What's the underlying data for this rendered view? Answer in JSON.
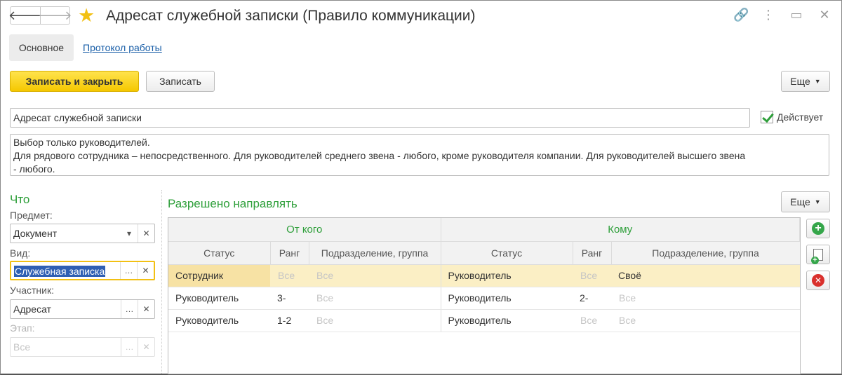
{
  "window": {
    "title": "Адресат служебной записки (Правило коммуникации)",
    "back_icon": "arrow-left-icon",
    "forward_icon": "arrow-right-icon",
    "favorite_icon": "star-icon",
    "icons": [
      "link-icon",
      "more-vertical-icon",
      "expand-icon",
      "close-icon"
    ]
  },
  "tabs": {
    "main": "Основное",
    "log": "Протокол работы"
  },
  "toolbar": {
    "save_close": "Записать и закрыть",
    "save": "Записать",
    "more": "Еще"
  },
  "form": {
    "name": "Адресат служебной записки",
    "active_label": "Действует",
    "active_checked": true,
    "description_lines": [
      "Выбор только руководителей.",
      "Для рядового сотрудника – непосредственного. Для руководителей среднего звена - любого, кроме руководителя компании. Для руководителей высшего звена",
      "- любого."
    ]
  },
  "what": {
    "title": "Что",
    "subject_label": "Предмет:",
    "subject_value": "Документ",
    "kind_label": "Вид:",
    "kind_value": "Служебная записка",
    "participant_label": "Участник:",
    "participant_value": "Адресат",
    "stage_label": "Этап:",
    "stage_value": "Все"
  },
  "allowed": {
    "title": "Разрешено направлять",
    "more": "Еще",
    "group_from": "От кого",
    "group_to": "Кому",
    "columns": [
      "Статус",
      "Ранг",
      "Подразделение, группа",
      "Статус",
      "Ранг",
      "Подразделение, группа"
    ],
    "rows": [
      [
        "Сотрудник",
        "Все",
        "Все",
        "Руководитель",
        "Все",
        "Своё"
      ],
      [
        "Руководитель",
        "3-",
        "Все",
        "Руководитель",
        "2-",
        "Все"
      ],
      [
        "Руководитель",
        "1-2",
        "Все",
        "Руководитель",
        "Все",
        "Все"
      ]
    ]
  },
  "colors": {
    "accent_green": "#2e9f3a",
    "primary_button": "#f5c800",
    "selection_row": "#fbefc5",
    "link": "#1a5fa8"
  }
}
